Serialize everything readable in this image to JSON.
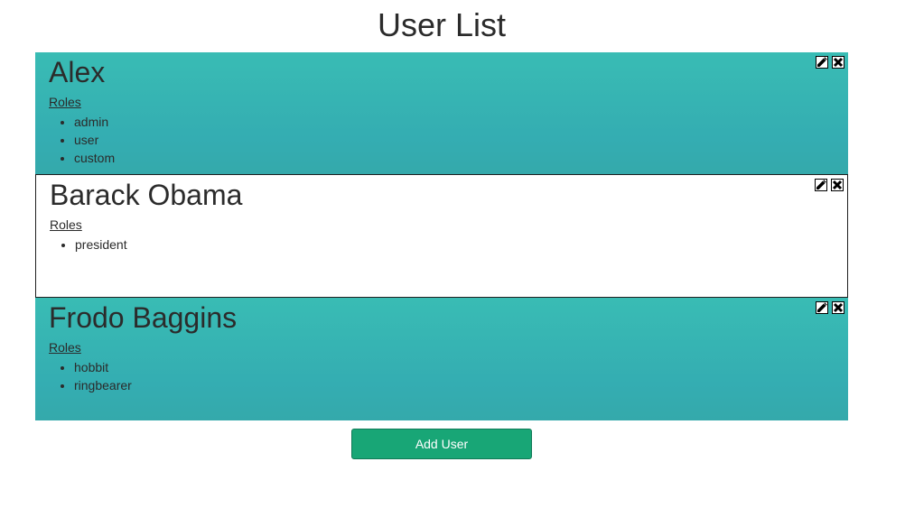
{
  "page": {
    "title": "User List"
  },
  "users": [
    {
      "name": "Alex",
      "roles_label": "Roles",
      "roles": [
        "admin",
        "user",
        "custom"
      ],
      "style": "teal"
    },
    {
      "name": "Barack Obama",
      "roles_label": "Roles",
      "roles": [
        "president"
      ],
      "style": "plain"
    },
    {
      "name": "Frodo Baggins",
      "roles_label": "Roles",
      "roles": [
        "hobbit",
        "ringbearer"
      ],
      "style": "teal"
    }
  ],
  "actions": {
    "add_user_label": "Add User"
  },
  "icons": {
    "edit": "pencil-icon",
    "delete": "close-icon"
  },
  "colors": {
    "card_teal": "#39bcb4",
    "button_green": "#18a676"
  }
}
